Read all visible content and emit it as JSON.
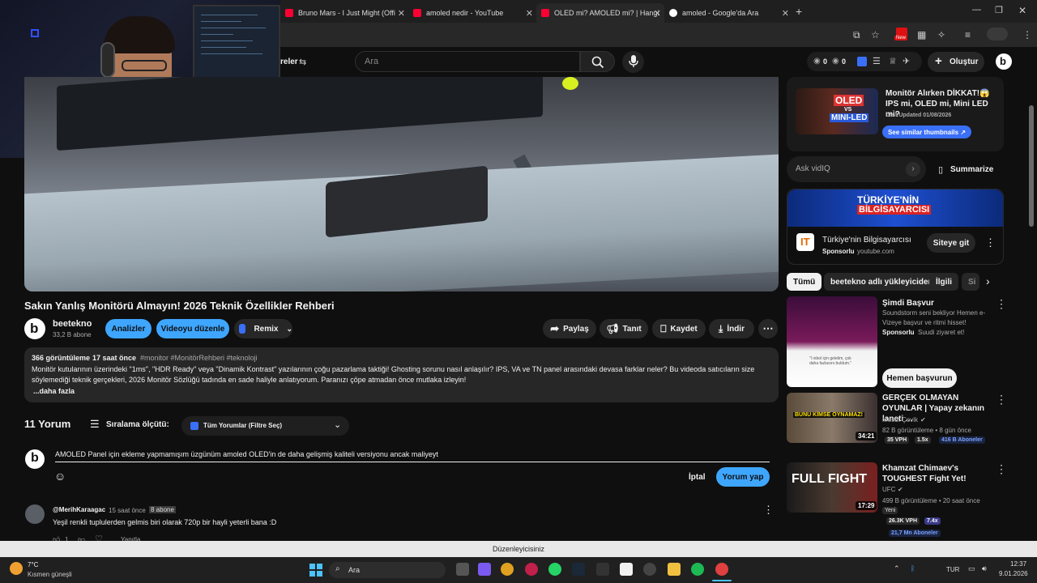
{
  "browser": {
    "tabs": [
      {
        "label": "Bruno Mars - I Just Might (Offi",
        "icon": "youtube-icon"
      },
      {
        "label": "amoled nedir - YouTube",
        "icon": "youtube-icon"
      },
      {
        "label": "OLED mi? AMOLED mi? | Hangi",
        "icon": "youtube-icon"
      },
      {
        "label": "amoled - Google'da Ara",
        "icon": "google-icon"
      }
    ],
    "new_tab": "+",
    "new_badge": "New"
  },
  "header": {
    "filter_label": "reler",
    "search_placeholder": "Ara",
    "views_count_1": "0",
    "views_count_2": "0",
    "create_label": "Oluştur"
  },
  "video": {
    "title": "Sakın Yanlış Monitörü Almayın! 2026 Teknik Özellikler Rehberi",
    "channel": "beetekno",
    "subscribers": "33,2 B abone",
    "analytics_btn": "Analizler",
    "edit_btn": "Videoyu düzenle",
    "remix_btn": "Remix",
    "share_btn": "Paylaş",
    "promote_btn": "Tanıt",
    "save_btn": "Kaydet",
    "download_btn": "İndir"
  },
  "description": {
    "views": "366 görüntüleme",
    "time": "17 saat önce",
    "tags": "#monitor #MonitörRehberi #teknoloji",
    "line1": "Monitör kutularının üzerindeki \"1ms\", \"HDR Ready\" veya \"Dinamik Kontrast\" yazılarının çoğu pazarlama taktiği! Ghosting sorunu nasıl anlaşılır? IPS, VA ve TN panel arasındaki devasa farklar neler? Bu videoda satıcıların size",
    "line2": "söylemediği teknik gerçekleri, 2026 Monitör Sözlüğü tadında en sade haliyle anlatıyorum. Paranızı çöpe atmadan önce mutlaka izleyin!",
    "more": "...daha fazla"
  },
  "comments": {
    "count": "11 Yorum",
    "sort_label": "Sıralama ölçütü:",
    "filter_dropdown": "Tüm Yorumlar (Filtre Seç)",
    "draft": "AMOLED Panel için ekleme yapmamışım üzgünüm amoled OLED'in de daha gelişmiş kaliteli versiyonu ancak maliyeyt",
    "cancel": "İptal",
    "submit": "Yorum yap",
    "items": [
      {
        "author": "@MerihKaraagac",
        "time": "15 saat önce",
        "badge": "8 abone",
        "text": "Yeşil renkli tuplulerden gelmis biri olarak 720p bir hayli yeterli bana :D",
        "likes": "1",
        "reply": "Yanıtla"
      }
    ]
  },
  "sidebar": {
    "vidiq_card": {
      "title": "Monitör Alırken DİKKAT!😱 IPS mi, OLED mi, Mini LED mi?",
      "updated": "Last Updated 01/08/2026",
      "button": "See similar thumbnails ↗",
      "thumb_text_1": "OLED",
      "thumb_text_2": "VS",
      "thumb_text_3": "MINI-LED"
    },
    "ask": {
      "placeholder": "Ask vidIQ",
      "summarize": "Summarize"
    },
    "ad": {
      "banner_line1": "TÜRKİYE'NİN",
      "banner_line2": "BİLGİSAYARCISI",
      "advertiser": "Türkiye'nin Bilgisayarcısı",
      "sponsored": "Sponsorlu",
      "domain": "youtube.com",
      "button": "Siteye git"
    },
    "chips": [
      "Tümü",
      "beetekno adlı yükleyiciden",
      "İlgili",
      "Si"
    ],
    "promo": {
      "title": "Şimdi Başvur",
      "desc": "Soundstorm seni bekliyor Hemen e-Vizeye başvur ve ritmi hisset!",
      "sponsored": "Sponsorlu",
      "advertiser": "Suudi ziyaret et!",
      "button": "Hemen başvurun",
      "quote": "\"l ınbol için gelelim, çok daha fazlasını buldum.\""
    },
    "videos": [
      {
        "title": "GERÇEK OLMAYAN OYUNLAR | Yapay zekanın laneti ...",
        "channel": "Mesut Çevik",
        "meta": "82 B görüntüleme • 8 gün önce",
        "vph": "35 VPH",
        "mult": "1.5x",
        "subs": "416 B Aboneler",
        "duration": "34:21",
        "thumb_text": "BUNU KİMSE OYNAMAZ!"
      },
      {
        "title": "Khamzat Chimaev's TOUGHEST Fight Yet!",
        "channel": "UFC",
        "meta": "499 B görüntüleme • 20 saat önce",
        "badge": "Yeni",
        "vph": "26.3K VPH",
        "mult": "7.4x",
        "subs": "21,7 Mn Aboneler",
        "duration": "17:29",
        "thumb_text": "FULL FIGHT"
      }
    ]
  },
  "bottom": {
    "editor": "Düzenleyicisiniz",
    "weather_temp": "7°C",
    "weather_desc": "Kısmen güneşli",
    "taskbar_search": "Ara",
    "lang": "TUR",
    "time": "12:37",
    "date": "9.01.2026"
  },
  "colors": {
    "accent_blue": "#3ea6ff",
    "yt_bg": "#0f0f0f",
    "card": "#272727"
  }
}
